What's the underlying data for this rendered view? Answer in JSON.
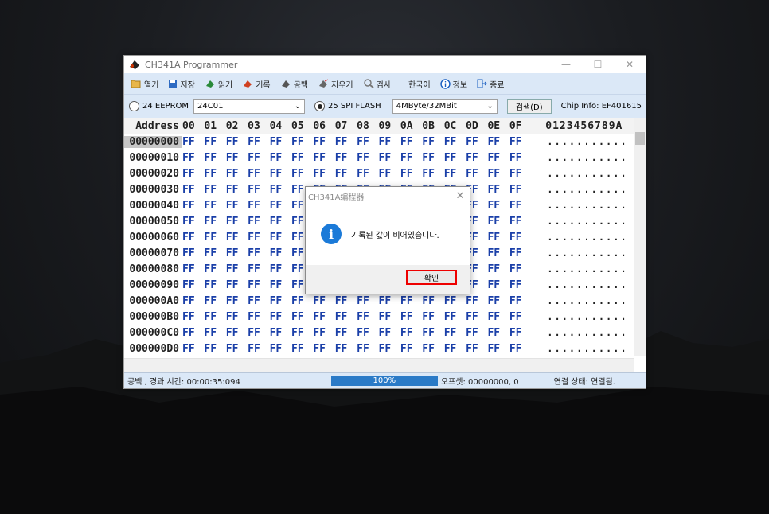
{
  "window": {
    "title": "CH341A Programmer",
    "icon": "chip-icon"
  },
  "toolbar": [
    {
      "label": "열기",
      "icon": "folder-open-icon"
    },
    {
      "label": "저장",
      "icon": "save-icon"
    },
    {
      "label": "읽기",
      "icon": "read-chip-icon"
    },
    {
      "label": "기록",
      "icon": "write-chip-icon"
    },
    {
      "label": "공백",
      "icon": "blank-check-icon"
    },
    {
      "label": "지우기",
      "icon": "erase-icon"
    },
    {
      "label": "검사",
      "icon": "verify-icon"
    },
    {
      "label": "한국어",
      "icon": ""
    },
    {
      "label": "정보",
      "icon": "info-icon"
    },
    {
      "label": "종료",
      "icon": "exit-icon"
    }
  ],
  "options": {
    "eeprom_label": "24 EEPROM",
    "eeprom_model": "24C01",
    "spi_label": "25 SPI FLASH",
    "spi_size": "4MByte/32MBit",
    "detect_label": "검색(D)",
    "chip_info": "Chip Info: EF401615"
  },
  "hex": {
    "header_label": "Address",
    "columns": [
      "00",
      "01",
      "02",
      "03",
      "04",
      "05",
      "06",
      "07",
      "08",
      "09",
      "0A",
      "0B",
      "0C",
      "0D",
      "0E",
      "0F"
    ],
    "ascii_header": "0123456789A",
    "rows": [
      {
        "addr": "00000000",
        "ascii": "..........."
      },
      {
        "addr": "00000010",
        "ascii": "..........."
      },
      {
        "addr": "00000020",
        "ascii": "..........."
      },
      {
        "addr": "00000030",
        "ascii": "..........."
      },
      {
        "addr": "00000040",
        "ascii": "..........."
      },
      {
        "addr": "00000050",
        "ascii": "..........."
      },
      {
        "addr": "00000060",
        "ascii": "..........."
      },
      {
        "addr": "00000070",
        "ascii": "..........."
      },
      {
        "addr": "00000080",
        "ascii": "..........."
      },
      {
        "addr": "00000090",
        "ascii": "..........."
      },
      {
        "addr": "000000A0",
        "ascii": "..........."
      },
      {
        "addr": "000000B0",
        "ascii": "..........."
      },
      {
        "addr": "000000C0",
        "ascii": "..........."
      },
      {
        "addr": "000000D0",
        "ascii": "..........."
      }
    ],
    "byte_value": "FF"
  },
  "status": {
    "left": "공백 , 경과 시간: 00:00:35:094",
    "progress": "100%",
    "offset": "오프셋: 00000000, 0",
    "connection": "연결 상태: 연결됨."
  },
  "dialog": {
    "title": "CH341A编程器",
    "message": "기록된 값이 비어있습니다.",
    "ok_label": "확인"
  },
  "colors": {
    "accent": "#1a3fa8",
    "progress": "#2a7ac7",
    "highlight": "#e00000"
  }
}
